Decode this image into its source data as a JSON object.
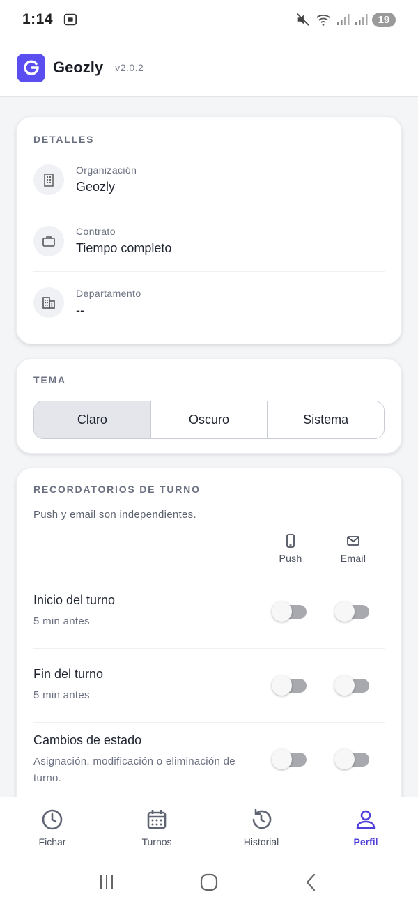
{
  "status_bar": {
    "time": "1:14",
    "battery": "19",
    "icons": [
      "screenshot-icon",
      "mute-icon",
      "wifi-icon",
      "signal-icon",
      "signal-icon-2"
    ]
  },
  "header": {
    "app_name": "Geozly",
    "version": "v2.0.2",
    "logo_color": "#5b4ef0"
  },
  "details": {
    "section_title": "DETALLES",
    "rows": [
      {
        "label": "Organización",
        "value": "Geozly",
        "icon": "building-icon"
      },
      {
        "label": "Contrato",
        "value": "Tiempo completo",
        "icon": "briefcase-icon"
      },
      {
        "label": "Departamento",
        "value": "--",
        "icon": "department-icon"
      }
    ]
  },
  "theme": {
    "section_title": "TEMA",
    "options": [
      "Claro",
      "Oscuro",
      "Sistema"
    ],
    "selected": "Claro"
  },
  "reminders": {
    "section_title": "RECORDATORIOS DE TURNO",
    "subtitle": "Push y email son independientes.",
    "channels": [
      {
        "label": "Push",
        "icon": "phone-icon"
      },
      {
        "label": "Email",
        "icon": "mail-icon"
      }
    ],
    "items": [
      {
        "title": "Inicio del turno",
        "description": "5 min antes",
        "push": false,
        "email": false
      },
      {
        "title": "Fin del turno",
        "description": "5 min antes",
        "push": false,
        "email": false
      },
      {
        "title": "Cambios de estado",
        "description": "Asignación, modificación o eliminación de turno.",
        "push": false,
        "email": false
      }
    ]
  },
  "bottom_nav": {
    "items": [
      {
        "label": "Fichar",
        "icon": "clock-icon"
      },
      {
        "label": "Turnos",
        "icon": "calendar-icon"
      },
      {
        "label": "Historial",
        "icon": "history-icon"
      },
      {
        "label": "Perfil",
        "icon": "person-icon"
      }
    ],
    "active": "Perfil",
    "active_color": "#4f3fd9"
  },
  "system_nav": [
    "recents-icon",
    "home-icon",
    "back-icon"
  ]
}
